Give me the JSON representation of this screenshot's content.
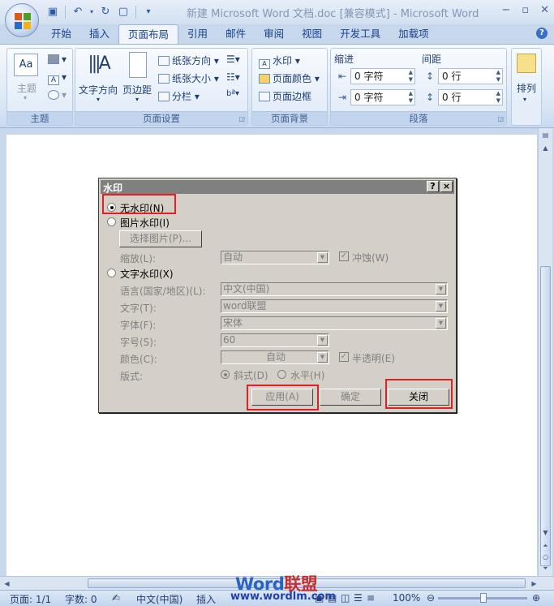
{
  "window": {
    "title": "新建 Microsoft Word 文档.doc [兼容模式] - Microsoft Word"
  },
  "tabs": [
    {
      "label": "开始"
    },
    {
      "label": "插入"
    },
    {
      "label": "页面布局",
      "active": true
    },
    {
      "label": "引用"
    },
    {
      "label": "邮件"
    },
    {
      "label": "审阅"
    },
    {
      "label": "视图"
    },
    {
      "label": "开发工具"
    },
    {
      "label": "加载项"
    }
  ],
  "ribbon": {
    "theme_group": {
      "label": "主题",
      "themes_label": "主题"
    },
    "page_setup_group": {
      "label": "页面设置",
      "text_direction": "文字方向",
      "margins": "页边距",
      "orientation": "纸张方向",
      "size": "纸张大小",
      "columns": "分栏"
    },
    "page_background_group": {
      "label": "页面背景",
      "watermark": "水印",
      "page_color": "页面颜色",
      "page_borders": "页面边框"
    },
    "paragraph_group": {
      "label": "段落",
      "indent_label": "缩进",
      "spacing_label": "间距",
      "indent_left": "0 字符",
      "indent_right": "0 字符",
      "spacing_before": "0 行",
      "spacing_after": "0 行"
    },
    "arrange_group": {
      "arrange": "排列"
    }
  },
  "dialog": {
    "title": "水印",
    "help": "?",
    "close_x": "×",
    "no_watermark": "无水印(N)",
    "picture_watermark": "图片水印(I)",
    "select_picture": "选择图片(P)...",
    "scale_label": "缩放(L):",
    "scale_value": "自动",
    "washout": "冲蚀(W)",
    "text_watermark": "文字水印(X)",
    "language_label": "语言(国家/地区)(L):",
    "language_value": "中文(中国)",
    "text_label": "文字(T):",
    "text_value": "word联盟",
    "font_label": "字体(F):",
    "font_value": "宋体",
    "size_label": "字号(S):",
    "size_value": "60",
    "color_label": "颜色(C):",
    "color_value": "自动",
    "semitransparent": "半透明(E)",
    "layout_label": "版式:",
    "diagonal": "斜式(D)",
    "horizontal": "水平(H)",
    "apply_button": "应用(A)",
    "ok_button": "确定",
    "close_button": "关闭"
  },
  "statusbar": {
    "page": "页面: 1/1",
    "words": "字数: 0",
    "language": "中文(中国)",
    "insert": "插入",
    "zoom": "100%"
  },
  "branding": {
    "logo_word": "Word",
    "logo_cn": "联盟",
    "url": "www.wordlm.com"
  },
  "colors": {
    "highlight": "#e31e24",
    "ribbon_text": "#15428b"
  }
}
